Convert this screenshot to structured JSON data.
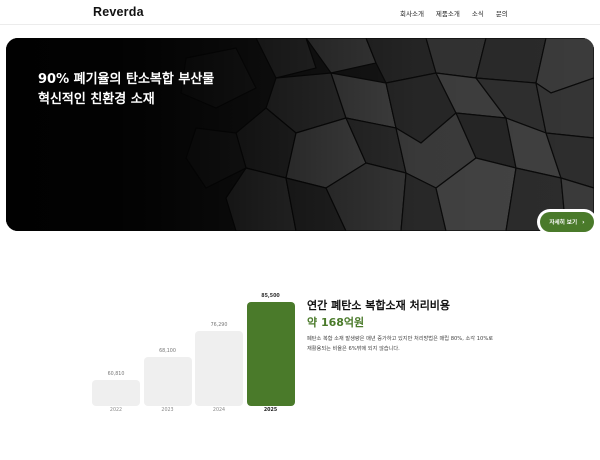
{
  "header": {
    "logo": "Reverda",
    "nav": [
      "회사소개",
      "제품소개",
      "소식",
      "문의"
    ]
  },
  "hero": {
    "title_line1": "90% 폐기율의 탄소복합 부산물",
    "title_line2": "혁신적인 친환경 소재",
    "button_label": "자세히 보기",
    "button_icon": "chevron-right-icon"
  },
  "chart_data": {
    "type": "bar",
    "categories": [
      "2022",
      "2023",
      "2024",
      "2025"
    ],
    "values": [
      60810,
      68100,
      76290,
      85500
    ],
    "value_labels": [
      "60,810",
      "68,100",
      "76,290",
      "85,500"
    ],
    "highlight": "2025",
    "highlight_color": "#4a7a2a",
    "bar_color": "#efefef"
  },
  "info": {
    "title": "연간 폐탄소 복합소재 처리비용",
    "amount": "약 168억원",
    "desc_line1": "폐탄소 복합 소재 발생량은 매년 증가하고 있지만 처리방법은 매립 80%, 소각 10%로",
    "desc_line2": "재활용되는 비율은 6%밖에 되지 않습니다."
  },
  "colors": {
    "accent": "#4a7a2a"
  }
}
